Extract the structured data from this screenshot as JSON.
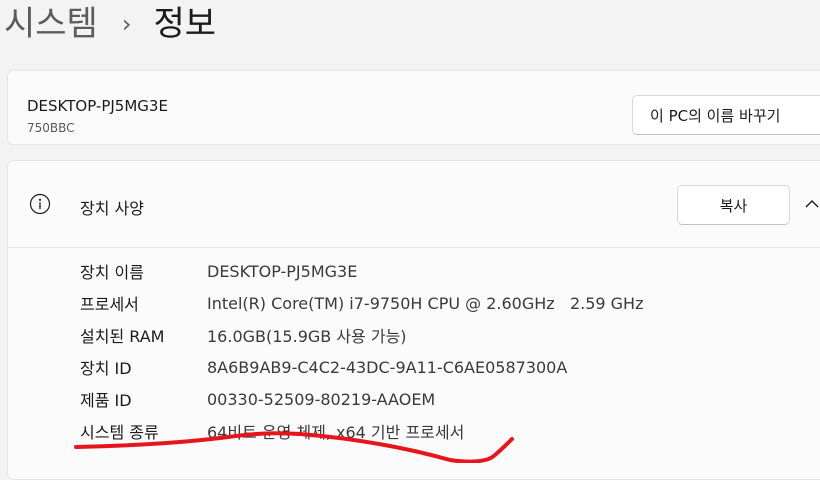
{
  "breadcrumb": {
    "parent": "시스템",
    "separator": "›",
    "current": "정보"
  },
  "device": {
    "name": "DESKTOP-PJ5MG3E",
    "model": "750BBC",
    "rename_label": "이 PC의 이름 바꾸기"
  },
  "specs": {
    "title": "장치 사양",
    "copy_label": "복사",
    "rows": [
      {
        "label": "장치 이름",
        "value": "DESKTOP-PJ5MG3E"
      },
      {
        "label": "프로세서",
        "value": "Intel(R) Core(TM) i7-9750H CPU @ 2.60GHz   2.59 GHz"
      },
      {
        "label": "설치된 RAM",
        "value": "16.0GB(15.9GB 사용 가능)"
      },
      {
        "label": "장치 ID",
        "value": "8A6B9AB9-C4C2-43DC-9A11-C6AE0587300A"
      },
      {
        "label": "제품 ID",
        "value": "00330-52509-80219-AAOEM"
      },
      {
        "label": "시스템 종류",
        "value": "64비트 운영 체제, x64 기반 프로세서"
      }
    ]
  },
  "annotation_color": "#e8141c"
}
